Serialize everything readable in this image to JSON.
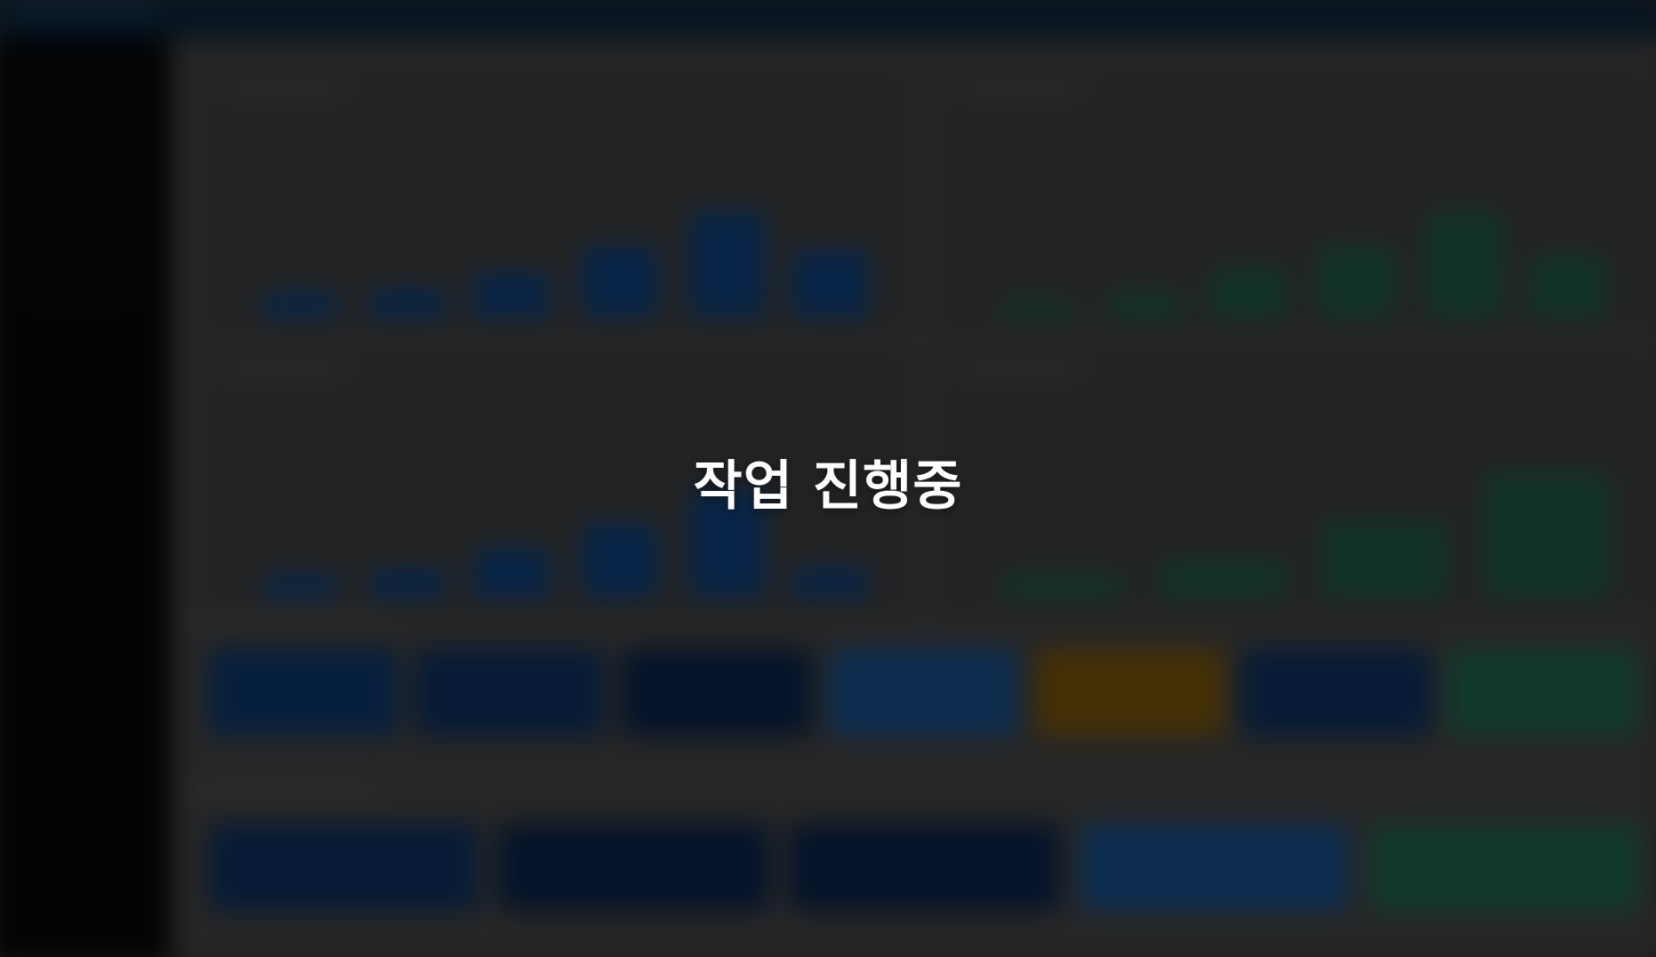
{
  "overlay": {
    "status_text": "작업 진행중"
  },
  "colors": {
    "overlay_tint": "rgba(0,0,0,0.35)",
    "primary_blue": "#0d3a6f",
    "success_green": "#1b4f3d",
    "warning_orange": "#6a4a0a",
    "sidebar_dark": "#050607",
    "main_gray": "#3b3b3b"
  }
}
